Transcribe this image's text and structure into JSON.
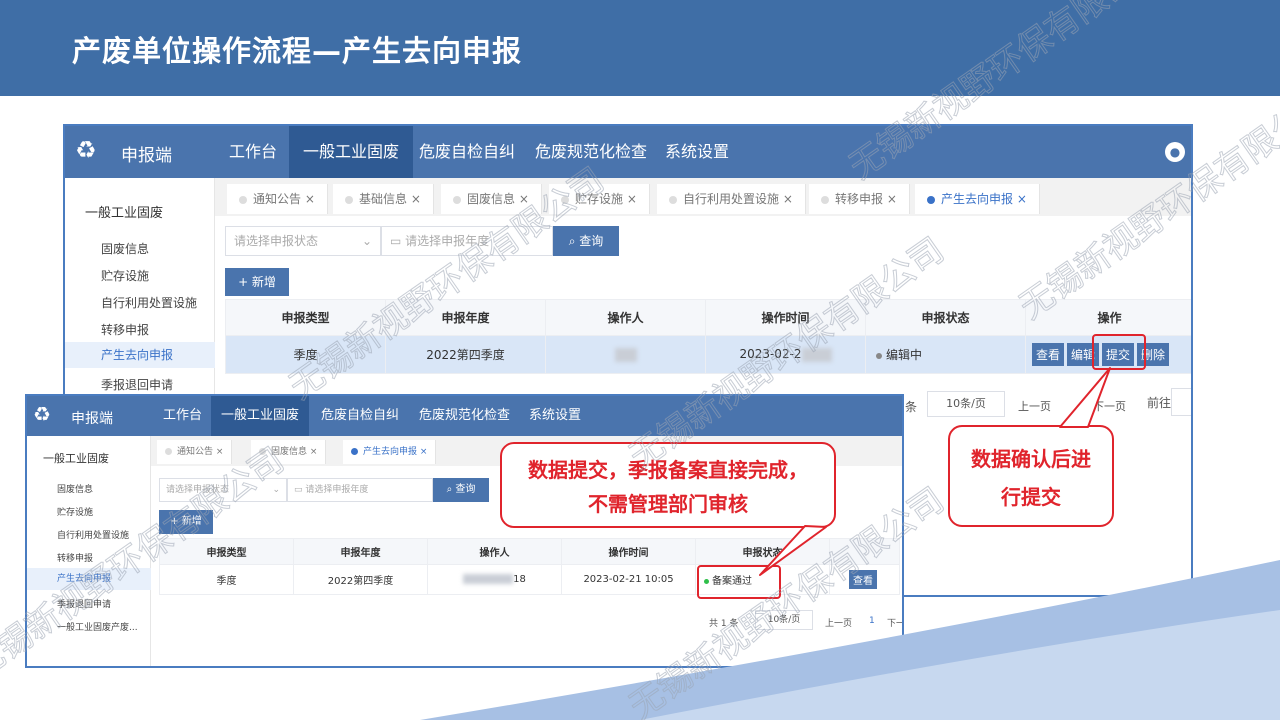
{
  "slide": {
    "title": "产废单位操作流程—产生去向申报"
  },
  "shot1": {
    "brand": "申报端",
    "nav": [
      "工作台",
      "一般工业固废",
      "危废自检自纠",
      "危废规范化检查",
      "系统设置"
    ],
    "sidebar_title": "一般工业固废",
    "sidebar": [
      "固废信息",
      "贮存设施",
      "自行利用处置设施",
      "转移申报",
      "产生去向申报",
      "季报退回申请"
    ],
    "tabs": [
      "通知公告",
      "基础信息",
      "固废信息",
      "贮存设施",
      "自行利用处置设施",
      "转移申报",
      "产生去向申报"
    ],
    "status_placeholder": "请选择申报状态",
    "year_placeholder": "请选择申报年度",
    "query": "查询",
    "add": "+ 新增",
    "headers": [
      "申报类型",
      "申报年度",
      "操作人",
      "操作时间",
      "申报状态",
      "操作"
    ],
    "row": {
      "type": "季度",
      "year": "2022第四季度",
      "time": "2023-02-2",
      "status": "编辑中"
    },
    "ops": [
      "查看",
      "编辑",
      "提交",
      "删除"
    ],
    "pager": {
      "total_suffix": "条",
      "size": "10条/页",
      "prev": "上一页",
      "next": "下一页",
      "goto": "前往"
    }
  },
  "shot2": {
    "brand": "申报端",
    "nav": [
      "工作台",
      "一般工业固废",
      "危废自检自纠",
      "危废规范化检查",
      "系统设置"
    ],
    "sidebar_title": "一般工业固废",
    "sidebar": [
      "固废信息",
      "贮存设施",
      "自行利用处置设施",
      "转移申报",
      "产生去向申报",
      "季报退回申请",
      "一般工业固废产废..."
    ],
    "tabs": [
      "通知公告",
      "固废信息",
      "产生去向申报"
    ],
    "status_placeholder": "请选择申报状态",
    "year_placeholder": "请选择申报年度",
    "query": "查询",
    "add": "+ 新增",
    "headers": [
      "申报类型",
      "申报年度",
      "操作人",
      "操作时间",
      "申报状态"
    ],
    "row": {
      "type": "季度",
      "year": "2022第四季度",
      "operator_tail": "18",
      "time": "2023-02-21 10:05",
      "status": "备案通过"
    },
    "op": "查看",
    "pager": {
      "total": "共 1 条",
      "size": "10条/页",
      "prev": "上一页",
      "page": "1",
      "next": "下一"
    }
  },
  "callouts": {
    "left": "数据提交，季报备案直接完成，不需管理部门审核",
    "right": "数据确认后进行提交"
  },
  "watermark": "无锡新视野环保有限公司",
  "colors": {
    "header": "#3f6ea6",
    "nav": "#4a74ad",
    "accent": "#3a72c8",
    "callout": "#e0242c",
    "success": "#2fbf4a"
  }
}
